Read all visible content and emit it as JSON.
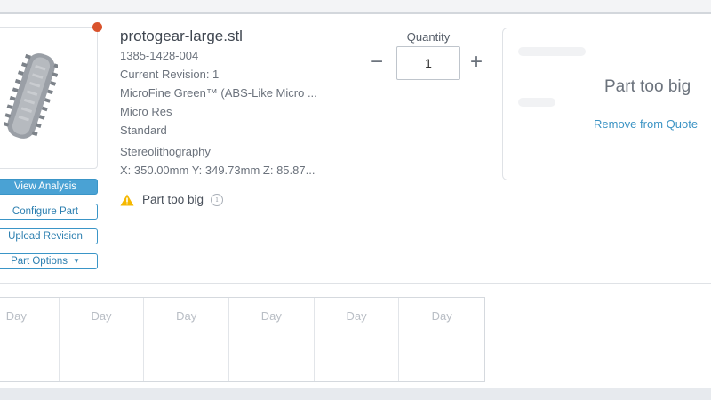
{
  "part": {
    "file_name": "protogear-large.stl",
    "part_number": "1385-1428-004",
    "revision": "Current Revision: 1",
    "material": "MicroFine Green™ (ABS-Like Micro ...",
    "resolution": "Micro Res",
    "finish": "Standard",
    "process": "Stereolithography",
    "dimensions": "X: 350.00mm Y: 349.73mm Z: 85.87...",
    "warning": "Part too big",
    "status_color": "#d9532c",
    "warning_icon": "warning-triangle-icon",
    "info_icon": "info-circle-icon"
  },
  "actions": {
    "view_analysis": "View Analysis",
    "configure_part": "Configure Part",
    "upload_revision": "Upload Revision",
    "part_options": "Part Options"
  },
  "quantity": {
    "label": "Quantity",
    "value": "1",
    "minus_symbol": "−",
    "plus_symbol": "+"
  },
  "price": {
    "status": "Part too big",
    "remove_label": "Remove from Quote"
  },
  "lead_times": [
    {
      "label": "Day"
    },
    {
      "label": "Day"
    },
    {
      "label": "Day"
    },
    {
      "label": "Day"
    },
    {
      "label": "Day"
    },
    {
      "label": "Day"
    }
  ],
  "colors": {
    "accent": "#3b93c4",
    "primary_button": "#4aa2d4",
    "warning": "#f5b800"
  }
}
